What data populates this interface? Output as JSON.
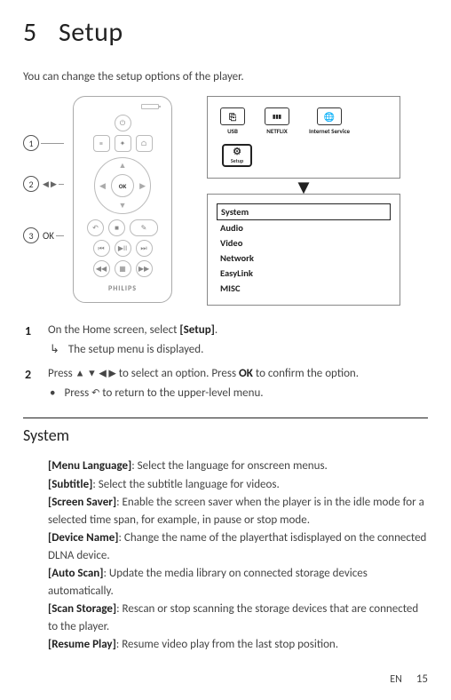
{
  "chapter": {
    "number": "5",
    "title": "Setup"
  },
  "intro": "You can change the setup options of the player.",
  "callouts": {
    "c1": "1",
    "c2_sym": "◀ ▶",
    "c3_label": "OK"
  },
  "remote": {
    "ok": "OK",
    "brand": "PHILIPS"
  },
  "home_screen": {
    "usb": "USB",
    "netflix": "NETFLIX",
    "internet": "Internet Service",
    "setup": "Setup"
  },
  "menu": {
    "items": [
      "System",
      "Audio",
      "Video",
      "Network",
      "EasyLink",
      "MISC"
    ]
  },
  "steps": {
    "s1_num": "1",
    "s1_text_a": "On the Home screen, select ",
    "s1_bold": "[Setup]",
    "s1_text_b": ".",
    "s1_sub": "The setup menu is displayed.",
    "s2_num": "2",
    "s2_text_a": "Press ",
    "s2_nav": "▲ ▼ ◀ ▶",
    "s2_text_b": " to select an option. Press ",
    "s2_ok": "OK",
    "s2_text_c": " to confirm the option.",
    "s2_sub_a": "Press ",
    "s2_back": "↶",
    "s2_sub_b": " to return to the upper-level menu."
  },
  "section": {
    "heading": "System"
  },
  "defs": {
    "menu_lang_k": "[Menu Language]",
    "menu_lang_v": ": Select the language for onscreen menus.",
    "subtitle_k": "[Subtitle]",
    "subtitle_v": ": Select the subtitle language for videos.",
    "saver_k": "[Screen Saver]",
    "saver_v": ": Enable the screen saver when the player is in the idle mode for a selected time span, for example, in pause or stop mode.",
    "device_k": "[Device Name]",
    "device_v": ": Change the name of the playerthat isdisplayed on the connected DLNA device.",
    "autoscan_k": "[Auto Scan]",
    "autoscan_v": ": Update the media library on connected storage devices automatically.",
    "scanstor_k": "[Scan Storage]",
    "scanstor_v": ": Rescan or stop scanning the storage devices that are connected to the player.",
    "resume_k": "[Resume Play]",
    "resume_v": ": Resume video play from the last stop position."
  },
  "footer": {
    "lang": "EN",
    "page": "15"
  }
}
